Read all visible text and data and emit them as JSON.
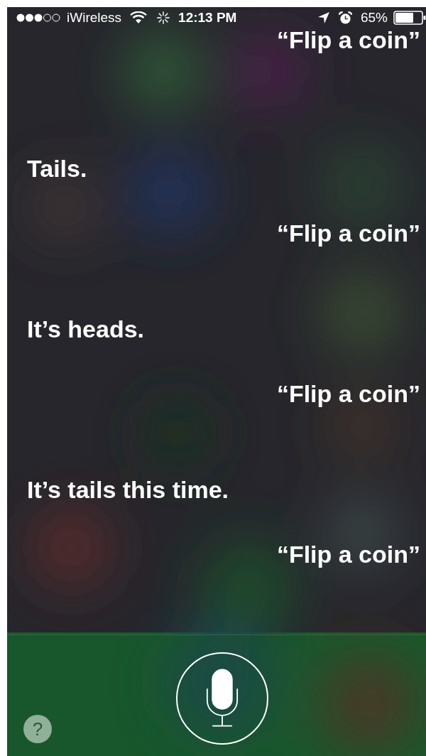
{
  "status_bar": {
    "carrier": "iWireless",
    "time": "12:13 PM",
    "battery": "65%"
  },
  "messages": [
    {
      "kind": "user",
      "text": "“Flip a coin”"
    },
    {
      "kind": "siri",
      "text": "Tails."
    },
    {
      "kind": "user",
      "text": "“Flip a coin”"
    },
    {
      "kind": "siri",
      "text": "It’s heads."
    },
    {
      "kind": "user",
      "text": "“Flip a coin”"
    },
    {
      "kind": "siri",
      "text": "It’s tails this time."
    },
    {
      "kind": "user",
      "text": "“Flip a coin”"
    }
  ],
  "help_button": {
    "label": "?"
  }
}
